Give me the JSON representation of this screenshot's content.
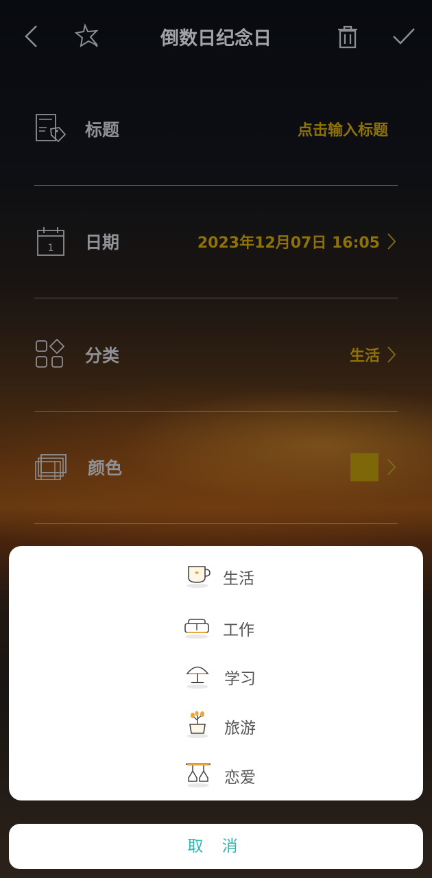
{
  "header": {
    "title": "倒数日纪念日",
    "icons": [
      "back-arrow-icon",
      "star-icon",
      "trash-icon",
      "checkmark-icon"
    ]
  },
  "form": {
    "title_label": "标题",
    "title_placeholder": "点击输入标题",
    "date_label": "日期",
    "date_value": "2023年12月07日 16:05",
    "category_label": "分类",
    "category_value": "生活",
    "color_label": "颜色",
    "color_value": "#7d6708"
  },
  "category_sheet": {
    "options": [
      {
        "label": "生活",
        "icon": "teacup-icon"
      },
      {
        "label": "工作",
        "icon": "sofa-icon"
      },
      {
        "label": "学习",
        "icon": "desk-lamp-icon"
      },
      {
        "label": "旅游",
        "icon": "plant-icon"
      },
      {
        "label": "恋爱",
        "icon": "wine-glasses-icon"
      }
    ],
    "cancel_label": "取 消"
  },
  "colors": {
    "accent_gold": "#8e7208",
    "cancel_teal": "#35b5b0"
  }
}
